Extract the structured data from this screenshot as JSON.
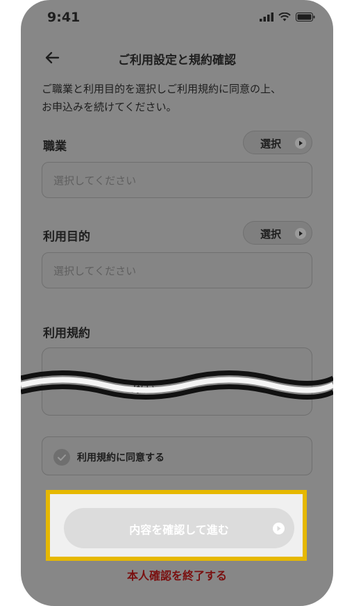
{
  "status_bar": {
    "time": "9:41",
    "icons": [
      "signal-icon",
      "wifi-icon",
      "battery-icon"
    ]
  },
  "header": {
    "title": "ご利用設定と規約確認",
    "back_icon": "arrow-left-icon"
  },
  "intro": {
    "line1": "ご職業と利用目的を選択しご利用規約に同意の上、",
    "line2": "お申込みを続けてください。"
  },
  "occupation": {
    "label": "職業",
    "select_label": "選択",
    "placeholder": "選択してください"
  },
  "purpose": {
    "label": "利用目的",
    "select_label": "選択",
    "placeholder": "選択してください"
  },
  "terms": {
    "label": "利用規約",
    "body_partial": "d払い"
  },
  "agree": {
    "label": "利用規約に同意する",
    "checked": false
  },
  "cta": {
    "label": "内容を確認して進む",
    "enabled": false
  },
  "footer": {
    "end_label": "本人確認を終了する"
  },
  "colors": {
    "overlay": "#878787",
    "highlight": "#e6b800",
    "end_link": "#7a1010"
  }
}
